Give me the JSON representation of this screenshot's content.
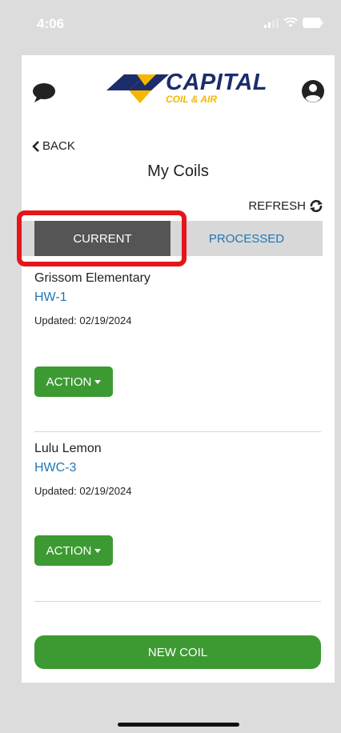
{
  "status": {
    "time": "4:06",
    "icons": [
      "signal-icon",
      "wifi-icon",
      "battery-icon"
    ]
  },
  "header": {
    "logo_title": "CAPITAL",
    "logo_subtitle": "COIL & AIR",
    "icons": [
      "chat-bubble-icon",
      "user-circle-icon"
    ]
  },
  "nav": {
    "back_label": "BACK",
    "page_title": "My Coils",
    "refresh_label": "REFRESH"
  },
  "tabs": [
    {
      "label": "CURRENT",
      "active": true
    },
    {
      "label": "PROCESSED",
      "active": false
    }
  ],
  "coils": [
    {
      "name": "Grissom Elementary",
      "id": "HW-1",
      "updated": "Updated: 02/19/2024",
      "action_label": "ACTION"
    },
    {
      "name": "Lulu Lemon",
      "id": "HWC-3",
      "updated": "Updated: 02/19/2024",
      "action_label": "ACTION"
    }
  ],
  "footer": {
    "new_coil_label": "NEW COIL"
  },
  "colors": {
    "brand_navy": "#1c2d6b",
    "brand_yellow": "#f5b700",
    "action_green": "#3d9a32",
    "link_blue": "#1f76b5",
    "highlight_red": "#e5161b",
    "active_tab": "#555555"
  }
}
